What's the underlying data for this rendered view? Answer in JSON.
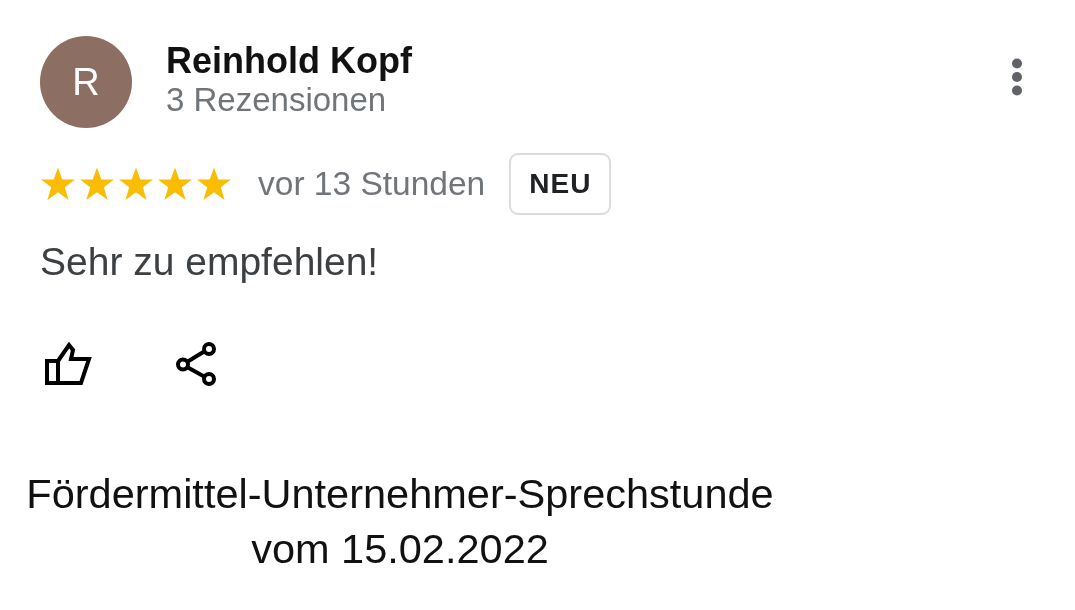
{
  "review": {
    "author": {
      "initial": "R",
      "name": "Reinhold Kopf",
      "review_count": "3 Rezensionen"
    },
    "stars": 5,
    "time": "vor 13 Stunden",
    "badge": "NEU",
    "text": "Sehr zu empfehlen!"
  },
  "caption": {
    "lines": [
      "Fördermittel-Unternehmer-Sprechstunde",
      "vom 15.02.2022"
    ]
  }
}
